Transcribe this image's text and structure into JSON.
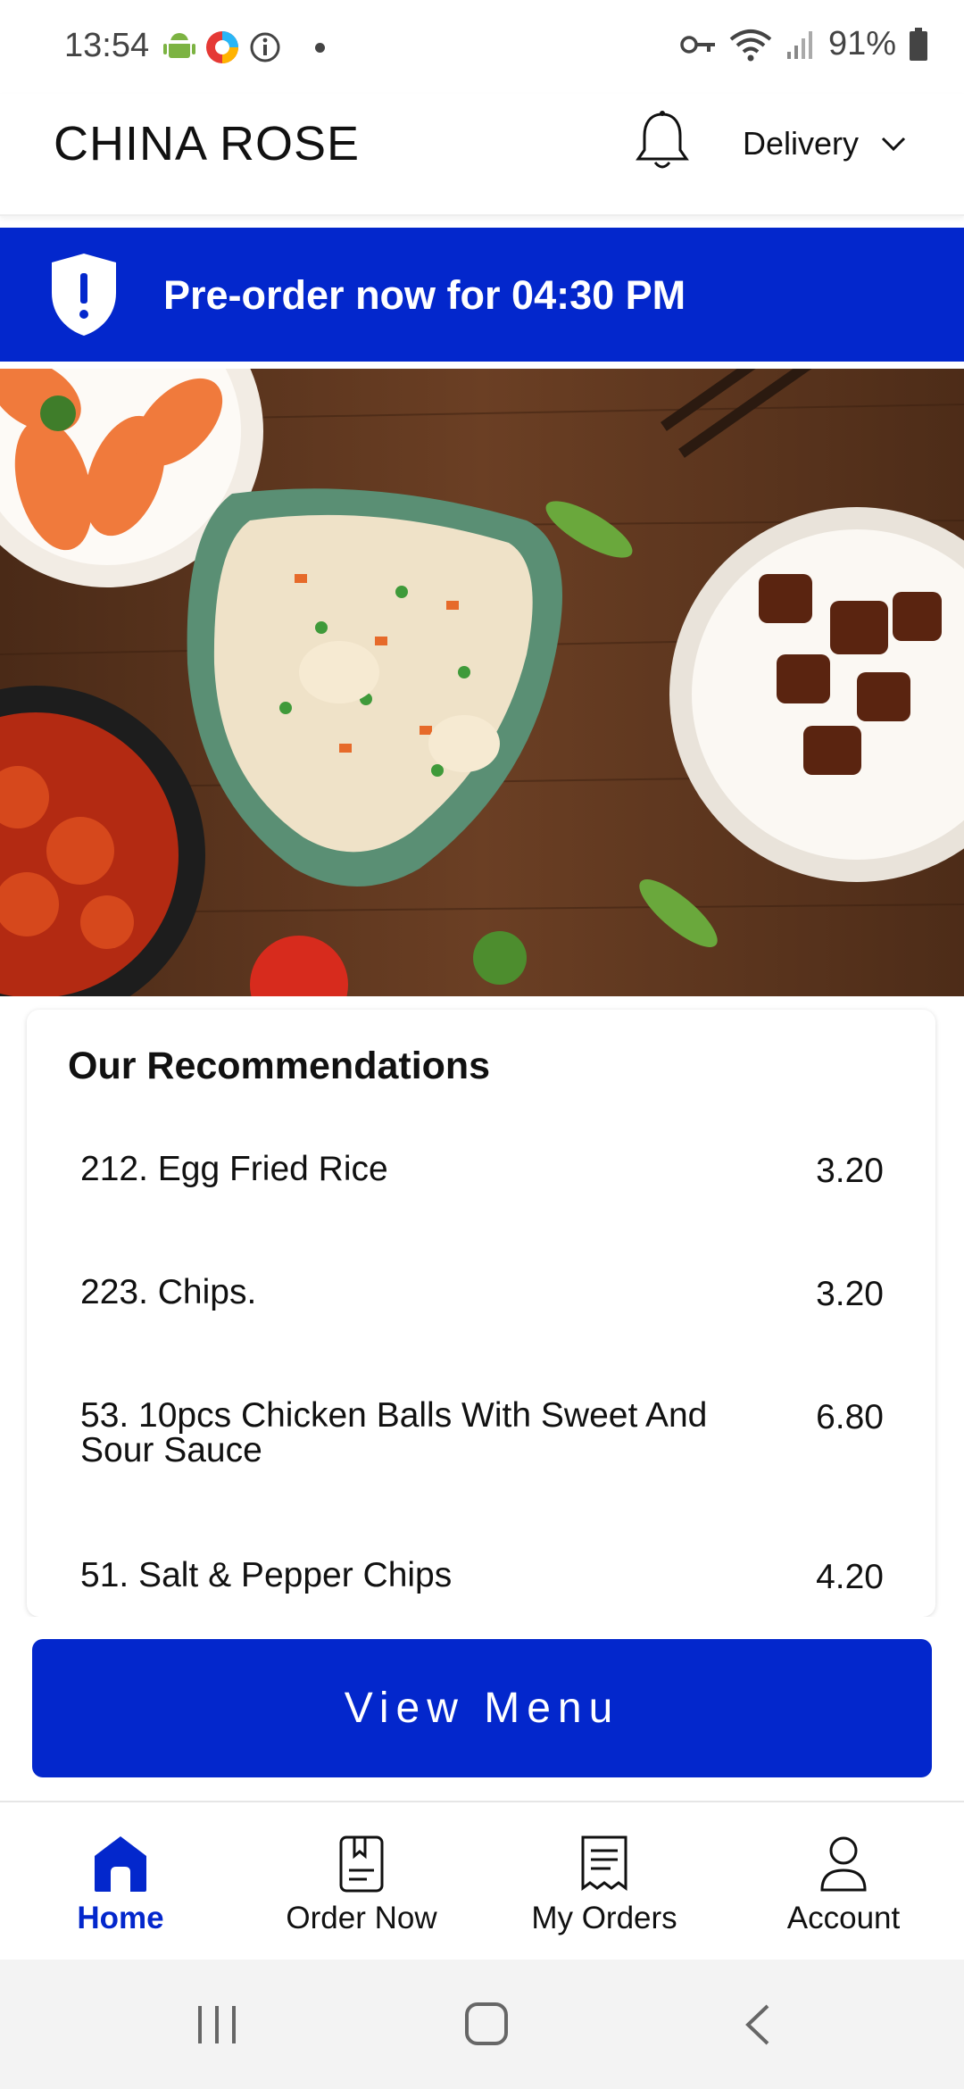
{
  "status_bar": {
    "time": "13:54",
    "battery": "91%",
    "icons": [
      "android-icon",
      "app-icon",
      "info-icon",
      "dot-icon",
      "key-icon",
      "wifi-icon",
      "signal-icon",
      "battery-icon"
    ]
  },
  "header": {
    "title": "CHINA ROSE",
    "mode": "Delivery",
    "icons": [
      "bell-icon",
      "chevron-down-icon"
    ]
  },
  "banner": {
    "text": "Pre-order now for 04:30 PM",
    "icon": "shield-alert-icon"
  },
  "recommendations": {
    "title": "Our Recommendations",
    "items": [
      {
        "name": "212. Egg Fried Rice",
        "price": "3.20"
      },
      {
        "name": "223. Chips.",
        "price": "3.20"
      },
      {
        "name": "53. 10pcs Chicken Balls With Sweet And Sour Sauce",
        "price": "6.80"
      },
      {
        "name": "51. Salt & Pepper Chips",
        "price": "4.20"
      }
    ]
  },
  "view_menu_label": "View Menu",
  "bottom_nav": [
    {
      "label": "Home",
      "icon": "home-icon",
      "active": true
    },
    {
      "label": "Order Now",
      "icon": "order-book-icon",
      "active": false
    },
    {
      "label": "My Orders",
      "icon": "receipt-icon",
      "active": false
    },
    {
      "label": "Account",
      "icon": "person-icon",
      "active": false
    }
  ],
  "colors": {
    "accent": "#0327cc",
    "text": "#111111",
    "muted": "#444444"
  }
}
